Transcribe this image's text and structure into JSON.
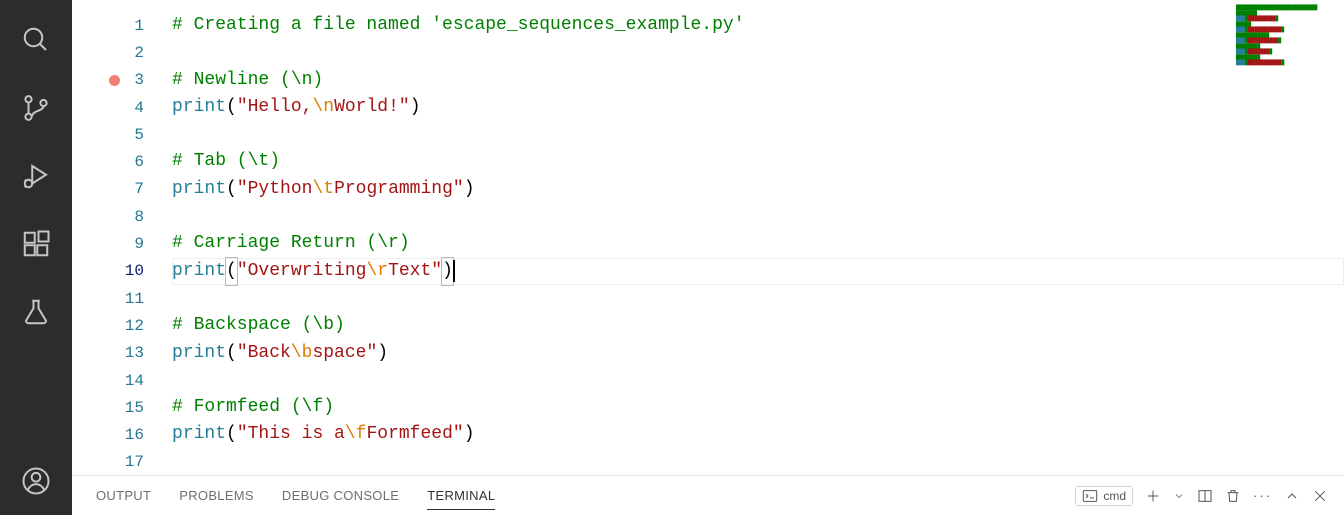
{
  "activity_items": [
    "search",
    "source-control",
    "run-debug",
    "extensions",
    "testing",
    "account"
  ],
  "code": {
    "breakpoint_line": 3,
    "current_line": 10,
    "lines": [
      {
        "n": 1,
        "tokens": [
          [
            "# Creating a file named 'escape_sequences_example.py'",
            "comment"
          ]
        ]
      },
      {
        "n": 2,
        "tokens": []
      },
      {
        "n": 3,
        "tokens": [
          [
            "# Newline (\\n)",
            "comment"
          ]
        ]
      },
      {
        "n": 4,
        "tokens": [
          [
            "print",
            "func"
          ],
          [
            "(",
            "punc"
          ],
          [
            "\"Hello,",
            "str"
          ],
          [
            "\\n",
            "esc"
          ],
          [
            "World!\"",
            "str"
          ],
          [
            ")",
            "punc"
          ]
        ]
      },
      {
        "n": 5,
        "tokens": []
      },
      {
        "n": 6,
        "tokens": [
          [
            "# Tab (\\t)",
            "comment"
          ]
        ]
      },
      {
        "n": 7,
        "tokens": [
          [
            "print",
            "func"
          ],
          [
            "(",
            "punc"
          ],
          [
            "\"Python",
            "str"
          ],
          [
            "\\t",
            "esc"
          ],
          [
            "Programming\"",
            "str"
          ],
          [
            ")",
            "punc"
          ]
        ]
      },
      {
        "n": 8,
        "tokens": []
      },
      {
        "n": 9,
        "tokens": [
          [
            "# Carriage Return (\\r)",
            "comment"
          ]
        ]
      },
      {
        "n": 10,
        "tokens": [
          [
            "print",
            "func"
          ],
          [
            "(",
            "punc-match"
          ],
          [
            "\"Overwriting",
            "str"
          ],
          [
            "\\r",
            "esc"
          ],
          [
            "Text\"",
            "str"
          ],
          [
            ")",
            "punc-match"
          ]
        ],
        "cursor": true
      },
      {
        "n": 11,
        "tokens": []
      },
      {
        "n": 12,
        "tokens": [
          [
            "# Backspace (\\b)",
            "comment"
          ]
        ]
      },
      {
        "n": 13,
        "tokens": [
          [
            "print",
            "func"
          ],
          [
            "(",
            "punc"
          ],
          [
            "\"Back",
            "str"
          ],
          [
            "\\b",
            "esc"
          ],
          [
            "space\"",
            "str"
          ],
          [
            ")",
            "punc"
          ]
        ]
      },
      {
        "n": 14,
        "tokens": []
      },
      {
        "n": 15,
        "tokens": [
          [
            "# Formfeed (\\f)",
            "comment"
          ]
        ]
      },
      {
        "n": 16,
        "tokens": [
          [
            "print",
            "func"
          ],
          [
            "(",
            "punc"
          ],
          [
            "\"This is a",
            "str"
          ],
          [
            "\\f",
            "esc"
          ],
          [
            "Formfeed\"",
            "str"
          ],
          [
            ")",
            "punc"
          ]
        ]
      },
      {
        "n": 17,
        "tokens": []
      }
    ]
  },
  "panel": {
    "tabs": [
      "OUTPUT",
      "PROBLEMS",
      "DEBUG CONSOLE",
      "TERMINAL"
    ],
    "active_tab": "TERMINAL",
    "terminal_name": "cmd"
  }
}
